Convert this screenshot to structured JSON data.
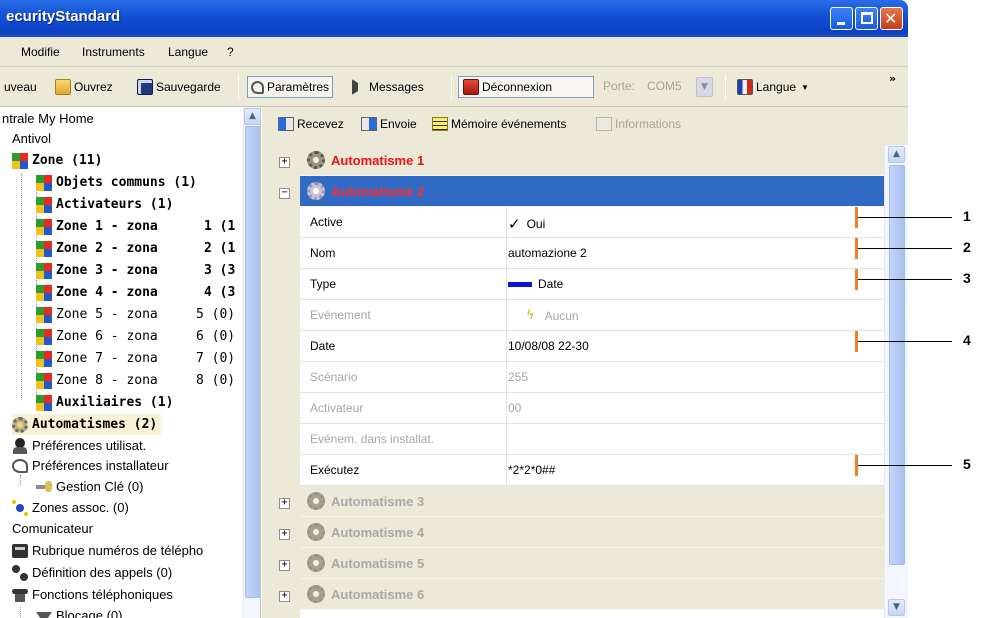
{
  "window": {
    "title": "ecurityStandard"
  },
  "menu": [
    "Modifie",
    "Instruments",
    "Langue",
    "?"
  ],
  "toolbar": {
    "nouveau": "uveau",
    "ouvrez": "Ouvrez",
    "sauvegarde": "Sauvegarde",
    "parametres": "Paramètres",
    "messages": "Messages",
    "deconnexion": "Déconnexion",
    "porte_label": "Porte:",
    "porte_value": "COM5",
    "langue": "Langue",
    "more": "»"
  },
  "tree": [
    {
      "label": "ntrale My Home",
      "style": "plain"
    },
    {
      "label": "Antivol",
      "style": "plain"
    },
    {
      "label": "Zone (11)",
      "style": "bold"
    },
    {
      "label": "Objets communs (1)",
      "style": "bold"
    },
    {
      "label": "Activateurs (1)",
      "style": "bold"
    },
    {
      "label": "Zone 1 - zona",
      "count": "1 (1",
      "style": "bold"
    },
    {
      "label": "Zone 2 - zona",
      "count": "2 (1",
      "style": "bold"
    },
    {
      "label": "Zone 3 - zona",
      "count": "3 (3",
      "style": "bold"
    },
    {
      "label": "Zone 4 - zona",
      "count": "4 (3",
      "style": "bold"
    },
    {
      "label": "Zone 5 - zona",
      "count": "5 (0)",
      "style": "mono"
    },
    {
      "label": "Zone 6 - zona",
      "count": "6 (0)",
      "style": "mono"
    },
    {
      "label": "Zone 7 - zona",
      "count": "7 (0)",
      "style": "mono"
    },
    {
      "label": "Zone 8 - zona",
      "count": "8 (0)",
      "style": "mono"
    },
    {
      "label": "Auxiliaires (1)",
      "style": "bold"
    },
    {
      "label": "Automatismes (2)",
      "style": "bold"
    },
    {
      "label": "Préférences utilisat.",
      "style": "plain"
    },
    {
      "label": "Préférences installateur",
      "style": "plain"
    },
    {
      "label": "Gestion Clé (0)",
      "style": "plain"
    },
    {
      "label": "Zones assoc. (0)",
      "style": "plain"
    },
    {
      "label": "Comunicateur",
      "style": "plain"
    },
    {
      "label": "Rubrique numéros de télépho",
      "style": "plain"
    },
    {
      "label": "Définition des appels (0)",
      "style": "plain"
    },
    {
      "label": "Fonctions téléphoniques",
      "style": "plain"
    },
    {
      "label": "Blocage (0)",
      "style": "plain"
    }
  ],
  "right_toolbar": {
    "recevez": "Recevez",
    "envoie": "Envoie",
    "memoire": "Mémoire événements",
    "informations": "Informations"
  },
  "groups": {
    "automatisme_1": "Automatisme 1",
    "automatisme_2": "Automatisme 2",
    "automatisme_3": "Automatisme 3",
    "automatisme_4": "Automatisme 4",
    "automatisme_5": "Automatisme 5",
    "automatisme_6": "Automatisme 6"
  },
  "properties": [
    {
      "key": "Active",
      "value": "Oui",
      "dim": false
    },
    {
      "key": "Nom",
      "value": "automazione 2",
      "dim": false
    },
    {
      "key": "Type",
      "value": "Date",
      "dim": false
    },
    {
      "key": "Evénement",
      "value": "Aucun",
      "dim": true
    },
    {
      "key": "Date",
      "value": "10/08/08 22-30",
      "dim": false
    },
    {
      "key": "Scénario",
      "value": "255",
      "dim": true
    },
    {
      "key": "Activateur",
      "value": "00",
      "dim": true
    },
    {
      "key": "Evénem. dans installat.",
      "value": "",
      "dim": true
    },
    {
      "key": "Exécutez",
      "value": "*2*2*0##",
      "dim": false
    }
  ],
  "callouts": [
    "1",
    "2",
    "3",
    "4",
    "5"
  ],
  "colors": {
    "titlebar": "#1451d6",
    "selected_row": "#316ac5",
    "group_title_red": "#ee1111",
    "callout_orange": "#f07f2a",
    "type_bar": "#0d12d9"
  }
}
